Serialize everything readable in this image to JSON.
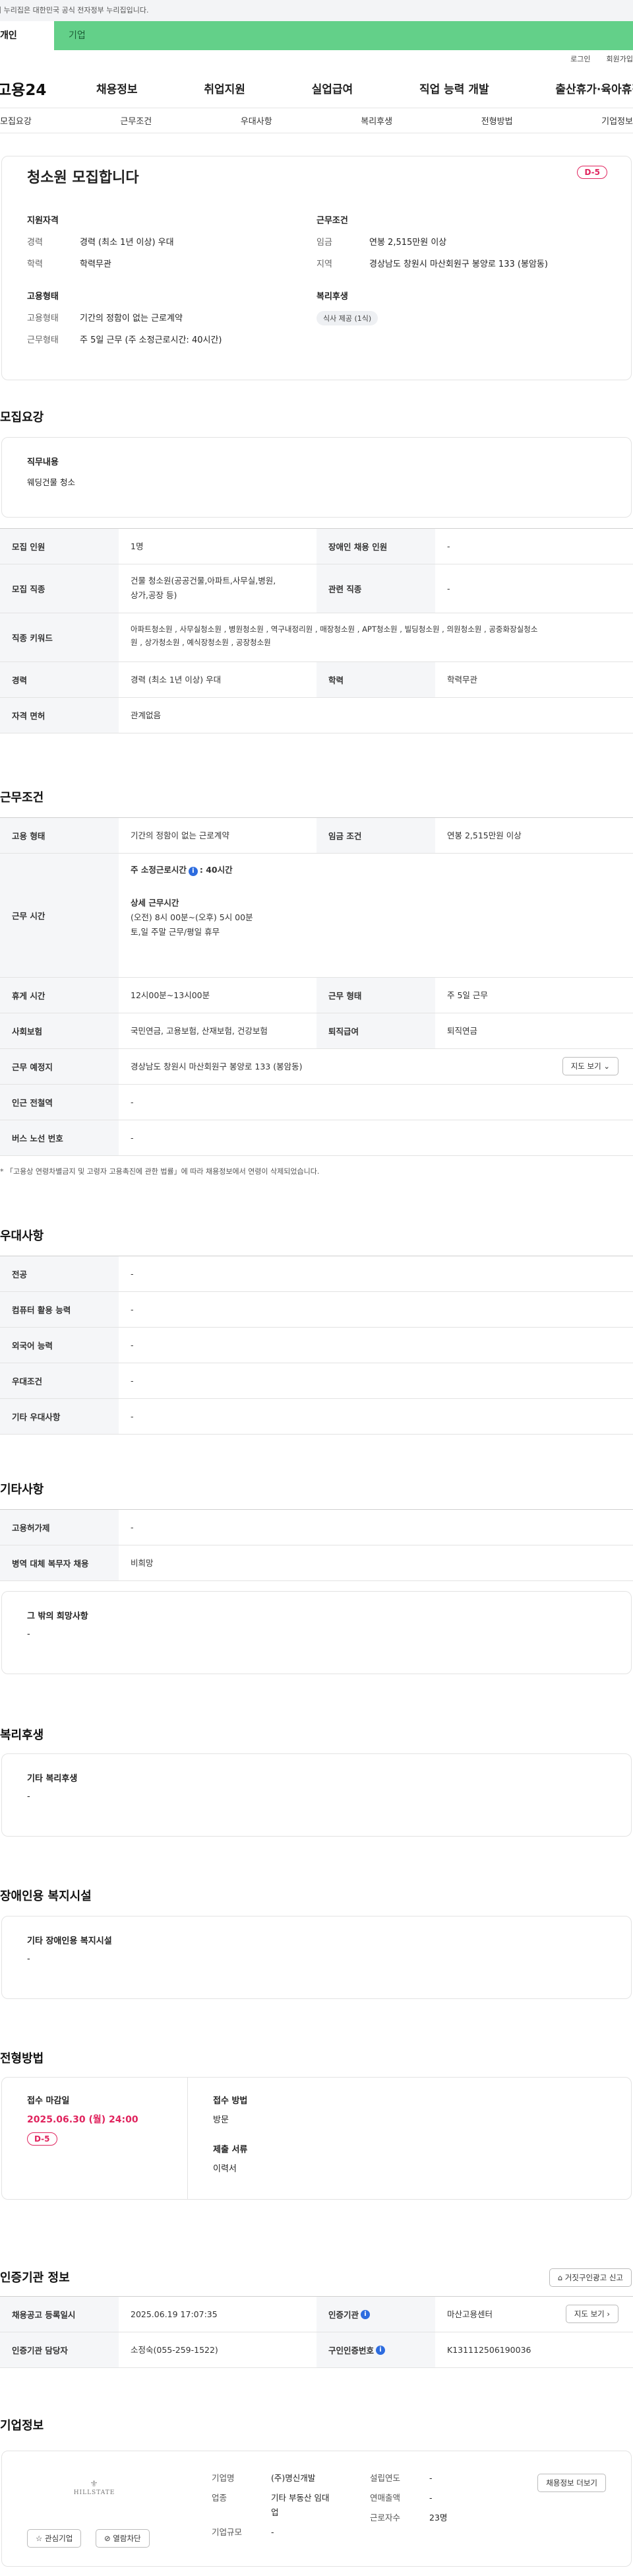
{
  "gov_banner": "이 누리집은 대한민국 공식 전자정부 누리집입니다.",
  "tabs": {
    "personal": "개인",
    "company": "기업"
  },
  "util": {
    "login": "로그인",
    "join": "회원가입"
  },
  "gnb": {
    "logo": "고용24",
    "menu": [
      "채용정보",
      "취업지원",
      "실업급여",
      "직업 능력 개발",
      "출산휴가·육아휴직"
    ]
  },
  "anchors": [
    "모집요강",
    "근무조건",
    "우대사항",
    "복리후생",
    "전형방법",
    "기업정보"
  ],
  "summary": {
    "title": "청소원 모집합니다",
    "dday": "D-5",
    "qual": {
      "heading": "지원자격",
      "career_k": "경력",
      "career_v": "경력 (최소 1년 이상) 우대",
      "edu_k": "학력",
      "edu_v": "학력무관"
    },
    "emp": {
      "heading": "고용형태",
      "type_k": "고용형태",
      "type_v": "기간의 정함이 없는 근로계약",
      "work_k": "근무형태",
      "work_v": "주 5일 근무 (주 소정근로시간: 40시간)"
    },
    "cond": {
      "heading": "근무조건",
      "wage_k": "임금",
      "wage_v": "연봉 2,515만원 이상",
      "area_k": "지역",
      "area_v": "경상남도 창원시 마산회원구 봉양로 133 (봉암동)"
    },
    "welfare": {
      "heading": "복리후생",
      "chip": "식사 제공 (1식)"
    }
  },
  "recruit": {
    "section": "모집요강",
    "job_heading": "직무내용",
    "job_text": "웨딩건물 청소",
    "rows": {
      "count_k": "모집 인원",
      "count_v": "1명",
      "disabled_k": "장애인 채용 인원",
      "disabled_v": "-",
      "job_k": "모집 직종",
      "job_v1": "건물 청소원(공공건물,아파트,사무실,병원,",
      "job_v2": "상가,공장 등)",
      "rel_k": "관련 직종",
      "rel_v": "-",
      "kw_k": "직종 키워드",
      "kw_v1": "아파트청소원 , 사무실청소원 , 병원청소원 , 역구내정리원 , 매장청소원 , APT청소원 , 빌딩청소원 , 의원청소원 , 공중화장실청소",
      "kw_v2": "원 , 상가청소원 , 예식장청소원 , 공장청소원",
      "career_k": "경력",
      "career_v": "경력 (최소 1년 이상) 우대",
      "edu_k": "학력",
      "edu_v": "학력무관",
      "license_k": "자격 면허",
      "license_v": "관계없음"
    }
  },
  "work": {
    "section": "근무조건",
    "type_k": "고용 형태",
    "type_v": "기간의 정함이 없는 근로계약",
    "wage_k": "임금 조건",
    "wage_v": "연봉 2,515만원 이상",
    "time_k": "근무 시간",
    "time_main": "주 소정근로시간",
    "time_main_v": ": 40시간",
    "time_detail_h": "상세 근무시간",
    "time_detail_1": "(오전) 8시 00분~(오후) 5시 00분",
    "time_detail_2": "토,일 주말 근무/평일 휴무",
    "rest_k": "휴게 시간",
    "rest_v": "12시00분~13시00분",
    "form_k": "근무 형태",
    "form_v": "주 5일 근무",
    "ins_k": "사회보험",
    "ins_v": "국민연금, 고용보험, 산재보험, 건강보험",
    "sev_k": "퇴직급여",
    "sev_v": "퇴직연금",
    "place_k": "근무 예정지",
    "place_v": "경상남도 창원시 마산회원구 봉양로 133 (봉암동)",
    "map_btn": "지도 보기",
    "subway_k": "인근 전철역",
    "subway_v": "-",
    "bus_k": "버스 노선 번호",
    "bus_v": "-",
    "note": "* 「고용상 연령차별금지 및 고령자 고용촉진에 관한 법률」에 따라 채용정보에서 연령이 삭제되었습니다."
  },
  "pref": {
    "section": "우대사항",
    "rows": [
      {
        "k": "전공",
        "v": "-"
      },
      {
        "k": "컴퓨터 활용 능력",
        "v": "-"
      },
      {
        "k": "외국어 능력",
        "v": "-"
      },
      {
        "k": "우대조건",
        "v": "-"
      },
      {
        "k": "기타 우대사항",
        "v": "-"
      }
    ]
  },
  "etc": {
    "section": "기타사항",
    "rows": [
      {
        "k": "고용허가제",
        "v": "-"
      },
      {
        "k": "병역 대체 복무자 채용",
        "v": "비희망"
      }
    ],
    "box_h": "그 밖의 희망사항",
    "box_v": "-"
  },
  "welfare": {
    "section": "복리후생",
    "box_h": "기타 복리후생",
    "box_v": "-"
  },
  "disab": {
    "section": "장애인용 복지시설",
    "box_h": "기타 장애인용 복지시설",
    "box_v": "-"
  },
  "screening": {
    "section": "전형방법",
    "deadline_h": "접수 마감일",
    "deadline_v": "2025.06.30 (월) 24:00",
    "dday": "D-5",
    "method_h": "접수 방법",
    "method_v": "방문",
    "docs_h": "제출 서류",
    "docs_v": "이력서"
  },
  "cert": {
    "section": "인증기관 정보",
    "report_btn": "거짓구인광고 신고",
    "reg_k": "채용공고 등록일시",
    "reg_v": "2025.06.19 17:07:35",
    "agency_k": "인증기관",
    "agency_v": "마산고용센터",
    "map_btn": "지도 보기",
    "manager_k": "인증기관 담당자",
    "manager_v": "소정숙(055-259-1522)",
    "num_k": "구인인증번호",
    "num_v": "K131112506190036"
  },
  "company": {
    "section": "기업정보",
    "logo_text": "HILLSTATE",
    "fav_btn": "관심기업",
    "block_btn": "열람차단",
    "name_k": "기업명",
    "name_v": "(주)명신개발",
    "ind_k": "업종",
    "ind_v1": "기타 부동산 임대",
    "ind_v2": "업",
    "size_k": "기업규모",
    "size_v": "-",
    "est_k": "설립연도",
    "est_v": "-",
    "sales_k": "연매출액",
    "sales_v": "-",
    "emp_k": "근로자수",
    "emp_v": "23명",
    "more_btn": "채용정보 더보기"
  }
}
